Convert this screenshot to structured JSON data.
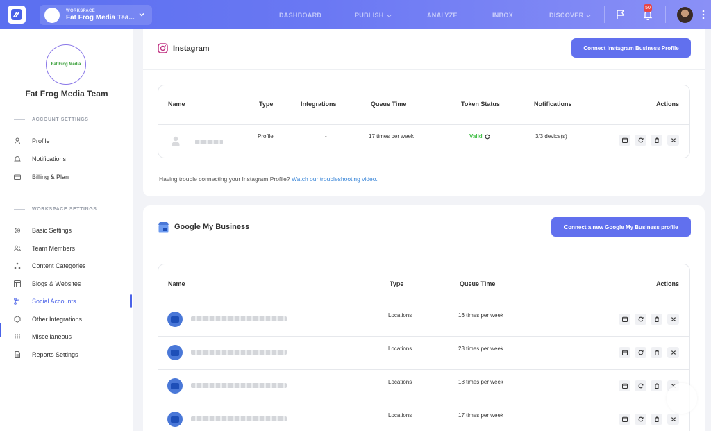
{
  "topbar": {
    "workspace_label": "WORKSPACE",
    "workspace_name": "Fat Frog Media Tea...",
    "nav": [
      "DASHBOARD",
      "PUBLISH",
      "ANALYZE",
      "INBOX",
      "DISCOVER"
    ],
    "notification_count": "50"
  },
  "sidebar": {
    "workspace_logo_text": "Fat Frog Media",
    "workspace_title": "Fat Frog Media Team",
    "account_heading": "ACCOUNT SETTINGS",
    "account_items": [
      "Profile",
      "Notifications",
      "Billing & Plan"
    ],
    "workspace_heading": "WORKSPACE SETTINGS",
    "workspace_items": [
      "Basic Settings",
      "Team Members",
      "Content Categories",
      "Blogs & Websites",
      "Social Accounts",
      "Other Integrations",
      "Miscellaneous",
      "Reports Settings"
    ],
    "active_item": "Social Accounts"
  },
  "instagram": {
    "title": "Instagram",
    "connect_button": "Connect Instagram Business Profile",
    "headers": [
      "Name",
      "Type",
      "Integrations",
      "Queue Time",
      "Token Status",
      "Notifications",
      "Actions"
    ],
    "row": {
      "type": "Profile",
      "integrations": "-",
      "queue_time": "17 times per week",
      "token_status": "Valid",
      "notifications": "3/3 device(s)"
    },
    "help_text": "Having trouble connecting your Instagram Profile?",
    "help_link": "Watch our troubleshooting video."
  },
  "gmb": {
    "title": "Google My Business",
    "connect_button": "Connect a new Google My Business profile",
    "headers": [
      "Name",
      "Type",
      "Queue Time",
      "Actions"
    ],
    "rows": [
      {
        "type": "Locations",
        "queue_time": "16 times per week"
      },
      {
        "type": "Locations",
        "queue_time": "23 times per week"
      },
      {
        "type": "Locations",
        "queue_time": "18 times per week"
      },
      {
        "type": "Locations",
        "queue_time": "17 times per week"
      }
    ]
  },
  "colors": {
    "accent": "#6170ee",
    "valid": "#45c04a",
    "link": "#3a86d8",
    "badge": "#e84545"
  }
}
